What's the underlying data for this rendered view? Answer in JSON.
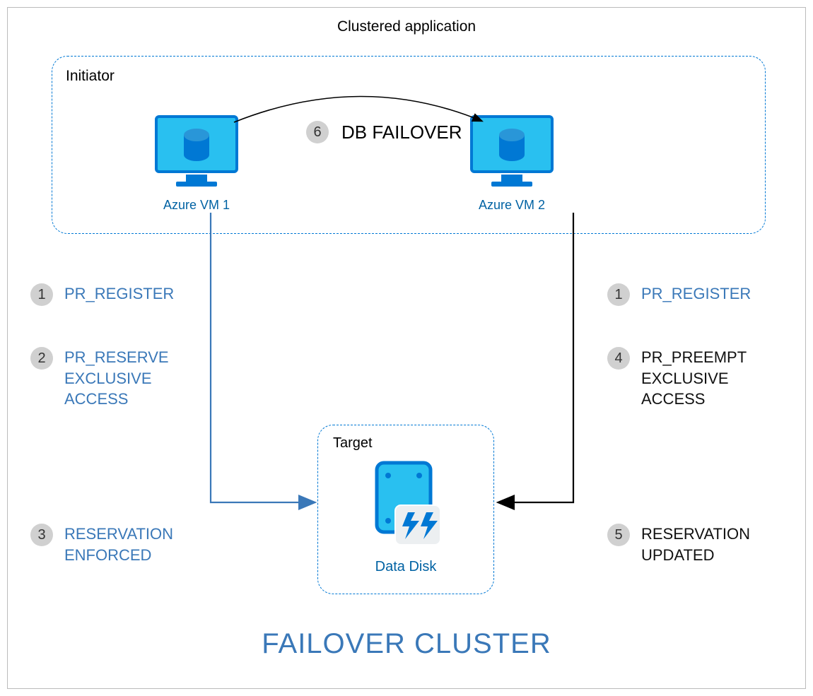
{
  "title": "Clustered application",
  "initiator": {
    "label": "Initiator",
    "vm1": "Azure VM 1",
    "vm2": "Azure VM 2"
  },
  "target": {
    "label": "Target",
    "disk": "Data Disk"
  },
  "failover": {
    "step": "6",
    "label": "DB FAILOVER"
  },
  "left_steps": {
    "s1": {
      "num": "1",
      "text": "PR_REGISTER"
    },
    "s2": {
      "num": "2",
      "text": "PR_RESERVE\nEXCLUSIVE\nACCESS"
    },
    "s3": {
      "num": "3",
      "text": "RESERVATION\nENFORCED"
    }
  },
  "right_steps": {
    "s1": {
      "num": "1",
      "text": "PR_REGISTER"
    },
    "s4": {
      "num": "4",
      "text": "PR_PREEMPT\nEXCLUSIVE\nACCESS"
    },
    "s5": {
      "num": "5",
      "text": "RESERVATION\nUPDATED"
    }
  },
  "footer": "FAILOVER CLUSTER"
}
